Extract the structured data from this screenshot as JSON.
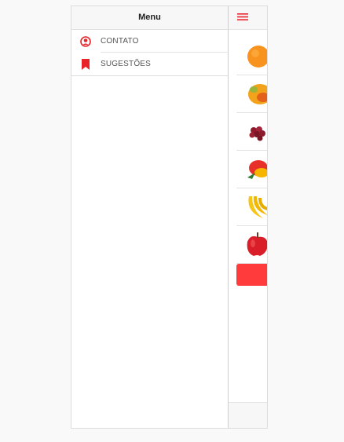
{
  "menu": {
    "title": "Menu",
    "items": [
      {
        "label": "CONTATO",
        "icon": "user-circle-icon"
      },
      {
        "label": "SUGESTÕES",
        "icon": "bookmark-icon"
      }
    ]
  },
  "main": {
    "header_icon": "hamburger-menu-icon",
    "fruits": [
      "orange",
      "papaya",
      "grapes",
      "mango",
      "banana",
      "apple"
    ]
  },
  "colors": {
    "accent": "#e8242a",
    "button": "#ff3b3b"
  }
}
